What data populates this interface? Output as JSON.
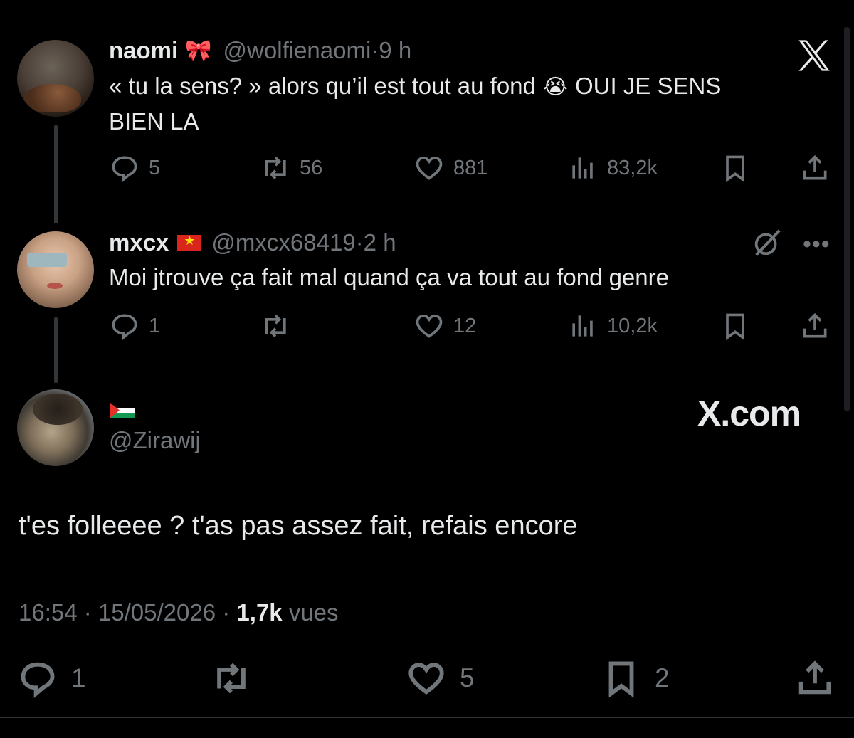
{
  "app": {
    "logo_text": "X.com",
    "logo_icon": "x-logo-icon"
  },
  "tweets": [
    {
      "name": "naomi",
      "name_emoji": "🎀",
      "handle": "@wolfienaomi",
      "time_sep": " · ",
      "time": "9 h",
      "text_part1": "« tu la sens? » alors qu’il est tout au fond",
      "text_emoji": "😭",
      "text_part2": "OUI JE SENS",
      "text_line2": "BIEN LA",
      "replies": "5",
      "retweets": "56",
      "likes": "881",
      "views": "83,2k"
    },
    {
      "name": "mxcx",
      "flag": "vietnam-flag",
      "handle": "@mxcx68419",
      "time_sep": " · ",
      "time": "2 h",
      "text": "Moi jtrouve ça fait mal quand ça va tout au fond genre",
      "replies": "1",
      "retweets": "",
      "likes": "12",
      "views": "10,2k"
    }
  ],
  "main_tweet": {
    "flag": "palestine-flag",
    "handle": "@Zirawij",
    "text": "t'es folleeee ? t'as pas assez fait, refais encore",
    "time": "16:54",
    "sep": " · ",
    "date": "15/05/2026",
    "views": "1,7k",
    "views_label": " vues",
    "replies": "1",
    "retweets": "",
    "likes": "5",
    "bookmarks": "2"
  },
  "colors": {
    "background": "#000000",
    "text": "#e7e9ea",
    "muted": "#71767b",
    "thread": "#333639"
  }
}
